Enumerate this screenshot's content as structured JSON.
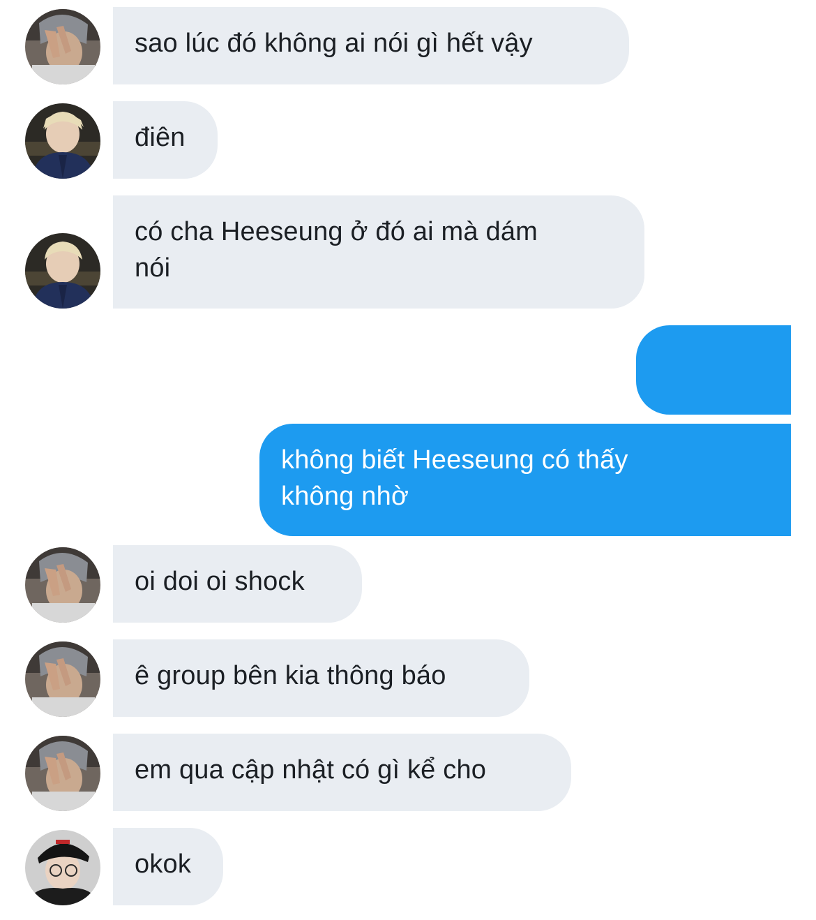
{
  "conversation": {
    "messages": [
      {
        "side": "in",
        "avatar": "avatar-gray-hair-peace-sign",
        "text": "sao lúc đó không ai nói gì hết vậy"
      },
      {
        "side": "in",
        "avatar": "avatar-blond-hair-navy-jacket",
        "text": "điên"
      },
      {
        "side": "in",
        "avatar": "avatar-blond-hair-navy-jacket",
        "text": "có cha Heeseung ở đó ai mà dám\nnói"
      },
      {
        "side": "out",
        "text": "😌 😌 😌"
      },
      {
        "side": "out",
        "text": "không biết Heeseung có thấy\nkhông nhờ"
      },
      {
        "side": "in",
        "avatar": "avatar-gray-hair-peace-sign",
        "text": "oi doi oi shock"
      },
      {
        "side": "in",
        "avatar": "avatar-gray-hair-peace-sign",
        "text": "ê group bên kia thông báo"
      },
      {
        "side": "in",
        "avatar": "avatar-gray-hair-peace-sign",
        "text": "em qua cập nhật có gì kể cho"
      },
      {
        "side": "in",
        "avatar": "avatar-black-cap-glasses",
        "text": "okok"
      }
    ]
  },
  "colors": {
    "incoming_bubble": "#e9edf2",
    "outgoing_bubble": "#1d9bf0",
    "incoming_text": "#1b1f24",
    "outgoing_text": "#ffffff"
  }
}
